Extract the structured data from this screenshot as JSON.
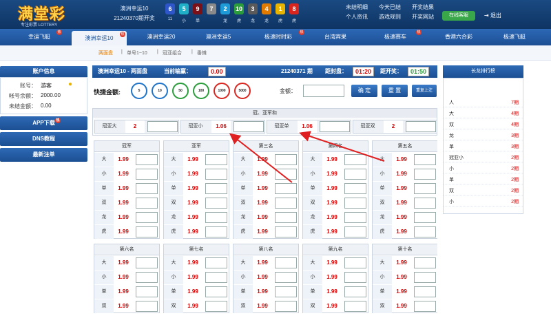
{
  "header": {
    "logo_text": "满堂彩",
    "logo_tagline": "专注彩票 LOTTERY",
    "draw_name": "澳洲幸运10",
    "draw_period": "21240370期开奖",
    "balls": [
      {
        "n": "6",
        "sub": "11",
        "color": "#2e56c9"
      },
      {
        "n": "5",
        "sub": "小",
        "color": "#1fb0c8"
      },
      {
        "n": "9",
        "sub": "单",
        "color": "#7a1018"
      },
      {
        "n": "7",
        "sub": "",
        "color": "#8a8a8a"
      },
      {
        "n": "2",
        "sub": "龙",
        "color": "#1e9ad6"
      },
      {
        "n": "10",
        "sub": "虎",
        "color": "#2a9c3a"
      },
      {
        "n": "3",
        "sub": "龙",
        "color": "#5a5a5a"
      },
      {
        "n": "4",
        "sub": "龙",
        "color": "#e07a00"
      },
      {
        "n": "1",
        "sub": "虎",
        "color": "#e8b400"
      },
      {
        "n": "8",
        "sub": "虎",
        "color": "#d8261f"
      }
    ],
    "links": [
      "未结明细",
      "今天已结",
      "开奖结果",
      "个人资讯",
      "游戏规则",
      "开奖网站"
    ],
    "online_label": "在线客服",
    "logout_label": "退出"
  },
  "nav": {
    "tabs": [
      "幸运飞艇",
      "澳洲幸运10",
      "澳洲幸运20",
      "澳洲幸运5",
      "极速时时彩",
      "台湾宾果",
      "极速赛车",
      "香港六合彩",
      "极速飞艇"
    ],
    "hot_badge": "热"
  },
  "subnav": {
    "items": [
      "两面盘",
      "单号1~10",
      "冠亚组合",
      "番摊"
    ]
  },
  "sidebar": {
    "title": "账户信息",
    "account_label": "账号：",
    "account": "游客",
    "balance_label": "帐号余额：",
    "balance": "2000.00",
    "unsettled_label": "未结金额：",
    "unsettled": "0.00",
    "buttons": [
      "APP下载",
      "DNS教程",
      "最新注单"
    ]
  },
  "infobar": {
    "game": "澳洲幸运10 - 两面盘",
    "profit_label": "当前输赢：",
    "profit": "0.00",
    "period": "21240371 期",
    "close_label": "距封盘：",
    "close_time": "01:20",
    "open_label": "距开奖：",
    "open_time": "01:50"
  },
  "bet": {
    "quick_label": "快捷金额:",
    "chips": [
      {
        "v": "5",
        "c": "#1e73c8"
      },
      {
        "v": "10",
        "c": "#1e73c8"
      },
      {
        "v": "50",
        "c": "#2a9c3a"
      },
      {
        "v": "100",
        "c": "#2a9c3a"
      },
      {
        "v": "1000",
        "c": "#d8261f"
      },
      {
        "v": "5000",
        "c": "#d8261f"
      }
    ],
    "amount_label": "金额：",
    "confirm": "确 定",
    "reset": "重 置",
    "repeat": "重复上注"
  },
  "lh": {
    "title": "冠、亚军和",
    "cells": [
      {
        "label": "冠亚大",
        "odds": "2"
      },
      {
        "label": "冠亚小",
        "odds": "1.06"
      },
      {
        "label": "冠亚单",
        "odds": "1.06"
      },
      {
        "label": "冠亚双",
        "odds": "2"
      }
    ]
  },
  "columns_top": [
    {
      "title": "冠军",
      "rows": [
        {
          "l": "大",
          "o": "1.99"
        },
        {
          "l": "小",
          "o": "1.99"
        },
        {
          "l": "单",
          "o": "1.99"
        },
        {
          "l": "双",
          "o": "1.99"
        },
        {
          "l": "龙",
          "o": "1.99"
        },
        {
          "l": "虎",
          "o": "1.99"
        }
      ]
    },
    {
      "title": "亚军",
      "rows": [
        {
          "l": "大",
          "o": "1.99"
        },
        {
          "l": "小",
          "o": "1.99"
        },
        {
          "l": "单",
          "o": "1.99"
        },
        {
          "l": "双",
          "o": "1.99"
        },
        {
          "l": "龙",
          "o": "1.99"
        },
        {
          "l": "虎",
          "o": "1.99"
        }
      ]
    },
    {
      "title": "第三名",
      "rows": [
        {
          "l": "大",
          "o": "1.99"
        },
        {
          "l": "小",
          "o": "1.99"
        },
        {
          "l": "单",
          "o": "1.99"
        },
        {
          "l": "双",
          "o": "1.99"
        },
        {
          "l": "龙",
          "o": "1.99"
        },
        {
          "l": "虎",
          "o": "1.99"
        }
      ]
    },
    {
      "title": "第四名",
      "rows": [
        {
          "l": "大",
          "o": "1.99"
        },
        {
          "l": "小",
          "o": "1.99"
        },
        {
          "l": "单",
          "o": "1.99"
        },
        {
          "l": "双",
          "o": "1.99"
        },
        {
          "l": "龙",
          "o": "1.99"
        },
        {
          "l": "虎",
          "o": "1.99"
        }
      ]
    },
    {
      "title": "第五名",
      "rows": [
        {
          "l": "大",
          "o": "1.99"
        },
        {
          "l": "小",
          "o": "1.99"
        },
        {
          "l": "单",
          "o": "1.99"
        },
        {
          "l": "双",
          "o": "1.99"
        },
        {
          "l": "龙",
          "o": "1.99"
        },
        {
          "l": "虎",
          "o": "1.99"
        }
      ]
    }
  ],
  "columns_bottom": [
    {
      "title": "第六名",
      "rows": [
        {
          "l": "大",
          "o": "1.99"
        },
        {
          "l": "小",
          "o": "1.99"
        },
        {
          "l": "单",
          "o": "1.99"
        },
        {
          "l": "双",
          "o": "1.99"
        }
      ]
    },
    {
      "title": "第七名",
      "rows": [
        {
          "l": "大",
          "o": "1.99"
        },
        {
          "l": "小",
          "o": "1.99"
        },
        {
          "l": "单",
          "o": "1.99"
        },
        {
          "l": "双",
          "o": "1.99"
        }
      ]
    },
    {
      "title": "第八名",
      "rows": [
        {
          "l": "大",
          "o": "1.99"
        },
        {
          "l": "小",
          "o": "1.99"
        },
        {
          "l": "单",
          "o": "1.99"
        },
        {
          "l": "双",
          "o": "1.99"
        }
      ]
    },
    {
      "title": "第九名",
      "rows": [
        {
          "l": "大",
          "o": "1.99"
        },
        {
          "l": "小",
          "o": "1.99"
        },
        {
          "l": "单",
          "o": "1.99"
        },
        {
          "l": "双",
          "o": "1.99"
        }
      ]
    },
    {
      "title": "第十名",
      "rows": [
        {
          "l": "大",
          "o": "1.99"
        },
        {
          "l": "小",
          "o": "1.99"
        },
        {
          "l": "单",
          "o": "1.99"
        },
        {
          "l": "双",
          "o": "1.99"
        }
      ]
    }
  ],
  "ranking": {
    "title": "长龙排行榜",
    "rows": [
      {
        "n": "人",
        "v": "7期"
      },
      {
        "n": "大",
        "v": "4期"
      },
      {
        "n": "双",
        "v": "4期"
      },
      {
        "n": "龙",
        "v": "3期"
      },
      {
        "n": "单",
        "v": "3期"
      },
      {
        "n": "冠亚小",
        "v": "2期"
      },
      {
        "n": "小",
        "v": "2期"
      },
      {
        "n": "单",
        "v": "2期"
      },
      {
        "n": "双",
        "v": "2期"
      },
      {
        "n": "小",
        "v": "2期"
      }
    ]
  }
}
